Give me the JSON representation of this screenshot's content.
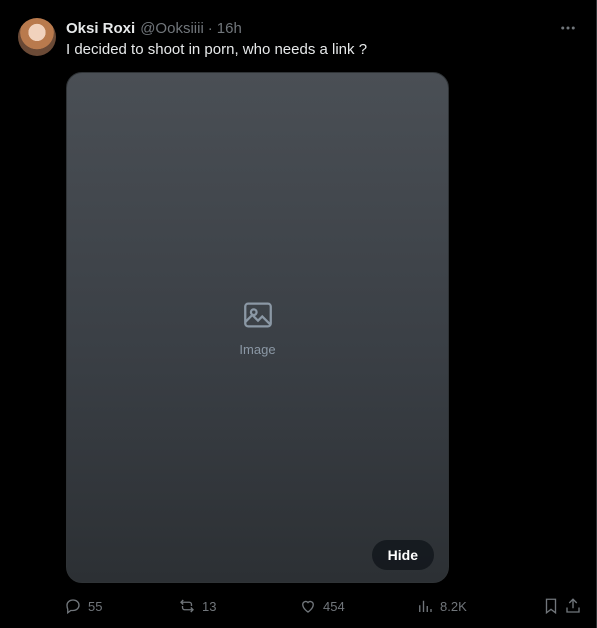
{
  "author": {
    "display_name": "Oksi Roxi",
    "handle": "@Ooksiiii",
    "separator": "·",
    "time": "16h"
  },
  "tweet": {
    "text": "I decided to shoot in porn, who needs a link ?"
  },
  "media": {
    "placeholder_label": "Image",
    "hide_label": "Hide"
  },
  "actions": {
    "replies": "55",
    "reposts": "13",
    "likes": "454",
    "views": "8.2K"
  },
  "icons": {
    "more": "more-horizontal-icon",
    "reply": "reply-icon",
    "repost": "repost-icon",
    "like": "heart-icon",
    "views": "views-chart-icon",
    "bookmark": "bookmark-icon",
    "share": "share-icon"
  },
  "colors": {
    "background": "#000000",
    "text_primary": "#e7e9ea",
    "text_secondary": "#71767b"
  }
}
